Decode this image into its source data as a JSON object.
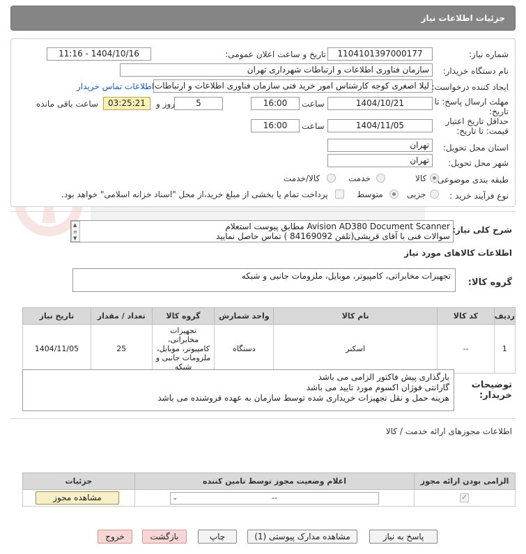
{
  "header": {
    "title": "جزئیات اطلاعات نیاز"
  },
  "info": {
    "need_number_label": "شماره نیاز:",
    "need_number": "1104101397000177",
    "announce_label": "تاریخ و ساعت اعلان عمومی:",
    "announce_value": "1404/10/16 - 11:16",
    "buyer_org_label": "نام دستگاه خریدار:",
    "buyer_org": "سازمان فناوری اطلاعات و ارتباطات شهرداری تهران",
    "creator_label": "ایجاد کننده درخواست:",
    "creator": "لیلا اصغری کوجه کارشناس امور خرید فنی سازمان فناوری اطلاعات و ارتباطات شه",
    "contact_link": "اطلاعات تماس خریدار",
    "reply_deadline_label_1": "مهلت ارسال پاسخ: تا",
    "reply_deadline_label_2": "تاریخ:",
    "reply_date": "1404/10/21",
    "time_label": "ساعت",
    "reply_time": "16:00",
    "days_value": "5",
    "days_label": "روز و",
    "remaining_time": "03:25:21",
    "remaining_label": "ساعت باقی مانده",
    "validity_label_1": "حداقل تاریخ اعتبار",
    "validity_label_2": "قیمت: تا تاریخ:",
    "validity_date": "1404/11/05",
    "validity_time": "16:00",
    "province_label": "استان محل تحویل:",
    "province": "تهران",
    "city_label": "شهر محل تحویل:",
    "city": "تهران",
    "category_label": "طبقه بندی موضوعی:",
    "category_options": [
      "کالا",
      "خدمت",
      "کالا/خدمت"
    ],
    "process_label": "نوع فرآیند خرید :",
    "process_options": [
      "جزیی",
      "متوسط"
    ],
    "payment_note": "پرداخت تمام یا بخشی از مبلغ خرید،از محل \"اسناد خزانه اسلامی\" خواهد بود."
  },
  "description": {
    "label": "شرح کلی نیاز:",
    "line1": "Avision AD380 Document Scanner  مطابق پیوست استعلام",
    "line2": "سوالات فنی با آقای قریشی(تلفن 84169092 ) تماس حاصل نمایید"
  },
  "goods": {
    "section_title": "اطلاعات کالاهای مورد نیاز",
    "group_label": "گروه کالا:",
    "group_value": "تجهیزات مخابراتی، کامپیوتر، موبایل، ملزومات جانبی و شبکه",
    "columns": [
      "ردیف",
      "کد کالا",
      "نام کالا",
      "واحد شمارش",
      "گروه کالا",
      "تعداد / مقدار",
      "تاریخ نیاز"
    ],
    "rows": [
      {
        "row": "1",
        "code": "--",
        "name": "اسکنر",
        "unit": "دستگاه",
        "group": "تجهیزات مخابراتی، کامپیوتر، موبایل، ملزومات جانبی و شبکه",
        "qty": "25",
        "date": "1404/11/05"
      }
    ]
  },
  "buyer_notes": {
    "label_1": "توضیحات",
    "label_2": "خریدار:",
    "line1": "بارگذاری پیش فاکتور الزامی می باشد",
    "line2": "گارانتی فوژان اکسوم مورد تایید می باشد",
    "line3": "هزینه حمل و نقل تجهیزات خریداری شده توسط سازمان به عهده فروشنده می باشد"
  },
  "permits": {
    "section_title": "اطلاعات مجوزهای ارائه خدمت / کالا",
    "columns": [
      "الزامی بودن ارائه مجوز",
      "اعلام وضعیت مجوز توسط تامین کننده",
      "جزئیات"
    ],
    "select_value": "--",
    "view_button": "مشاهده مجوز"
  },
  "actions": {
    "reply": "پاسخ به نیاز",
    "attachments": "مشاهده مدارک پیوستی (1)",
    "print": "چاپ",
    "back": "بازگشت",
    "exit": "خروج"
  },
  "colors": {
    "header_bg": "#858585",
    "link": "#1a56c9",
    "timer_bg": "#fbf2b8"
  }
}
